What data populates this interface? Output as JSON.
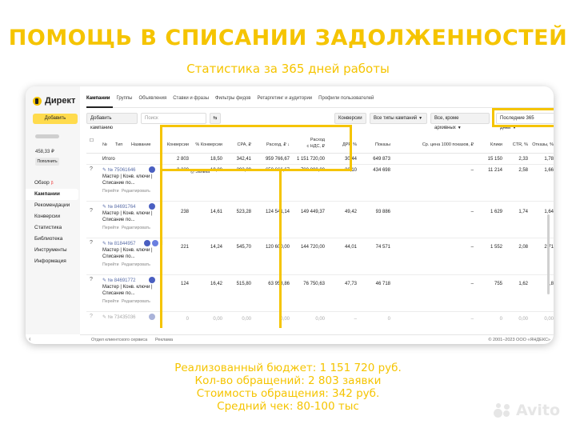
{
  "headline": "ПОМОЩЬ В СПИСАНИИ ЗАДОЛЖЕННОСТЕЙ",
  "subheadline": "Статистика за 365 дней работы",
  "app": {
    "logo": "Директ",
    "add_button": "Добавить",
    "balance": "458,33 ₽",
    "topup_button": "Пополнить",
    "menu": [
      {
        "label": "Обзор",
        "beta": "β"
      },
      {
        "label": "Кампании",
        "active": true
      },
      {
        "label": "Рекомендации"
      },
      {
        "label": "Конверсии"
      },
      {
        "label": "Статистика"
      },
      {
        "label": "Библиотека"
      },
      {
        "label": "Инструменты"
      },
      {
        "label": "Информация"
      }
    ],
    "tabs": [
      "Кампании",
      "Группы",
      "Объявления",
      "Ставки и фразы",
      "Фильтры фидов",
      "Ретаргетинг и аудитории",
      "Профили пользователей"
    ],
    "toolbar": {
      "add_campaign": "Добавить кампанию",
      "search_placeholder": "Поиск",
      "conversions": "Конверсии",
      "campaign_types": "Все типы кампаний",
      "archive_filter": "Все, кроме архивных",
      "period": "Последние 365 дней"
    },
    "goal_label": "Заявка",
    "columns": {
      "no": "№",
      "type": "Тип",
      "name": "Название",
      "conversions": "Конверсии",
      "conv_pct": "% Конверсии",
      "cpa": "CPA, ₽",
      "spend": "Расход, ₽ ↓",
      "spend_vat_1": "Расход",
      "spend_vat_2": "с НДС, ₽",
      "drr": "ДРР, %",
      "impressions": "Показы",
      "avg_cpm": "Ср. цена 1000 показов, ₽",
      "clicks": "Клики",
      "ctr": "CTR, %",
      "bounce": "Отказы, %"
    },
    "total": {
      "label": "Итого",
      "conversions": "2 803",
      "conv_pct": "18,50",
      "cpa": "342,41",
      "spend": "959 766,67",
      "spend_vat": "1 151 720,00",
      "drr": "30,44",
      "impressions": "649 873",
      "avg_cpm": "",
      "clicks": "15 150",
      "ctr": "2,33",
      "bounce": "1,78"
    },
    "rows": [
      {
        "id": "№ 75061646",
        "name1": "Мастер | Конв. ключи |",
        "name2": "Списание по...",
        "go": "Перейти",
        "edit": "Редактировать",
        "conversions": "2 220",
        "conv_pct": "19,80",
        "cpa": "293,09",
        "spend": "650 666,67",
        "spend_vat": "780 800,00",
        "drr": "26,10",
        "impressions": "434 698",
        "avg_cpm": "–",
        "clicks": "11 214",
        "ctr": "2,58",
        "bounce": "1,66"
      },
      {
        "id": "№ 84691764",
        "name1": "Мастер | Конв. ключи |",
        "name2": "Списание по...",
        "go": "Перейти",
        "edit": "Редактировать",
        "conversions": "238",
        "conv_pct": "14,61",
        "cpa": "523,28",
        "spend": "124 541,14",
        "spend_vat": "149 449,37",
        "drr": "49,42",
        "impressions": "93 886",
        "avg_cpm": "–",
        "clicks": "1 629",
        "ctr": "1,74",
        "bounce": "1,64"
      },
      {
        "id": "№ 81844957",
        "name1": "Мастер | Конв. ключи |",
        "name2": "Списание по...",
        "go": "Перейти",
        "edit": "Редактировать",
        "conversions": "221",
        "conv_pct": "14,24",
        "cpa": "545,70",
        "spend": "120 600,00",
        "spend_vat": "144 720,00",
        "drr": "44,01",
        "impressions": "74 571",
        "avg_cpm": "–",
        "clicks": "1 552",
        "ctr": "2,08",
        "bounce": "2,71"
      },
      {
        "id": "№ 84691772",
        "name1": "Мастер | Конв. ключи |",
        "name2": "Списание по...",
        "go": "Перейти",
        "edit": "Редактировать",
        "conversions": "124",
        "conv_pct": "16,42",
        "cpa": "515,80",
        "spend": "63 958,86",
        "spend_vat": "76 750,63",
        "drr": "47,73",
        "impressions": "46 718",
        "avg_cpm": "–",
        "clicks": "755",
        "ctr": "1,62",
        "bounce": "1,8"
      },
      {
        "id": "№ 73435036",
        "name1": "",
        "name2": "",
        "go": "",
        "edit": "",
        "conversions": "0",
        "conv_pct": "0,00",
        "cpa": "0,00",
        "spend": "0,00",
        "spend_vat": "0,00",
        "drr": "–",
        "impressions": "0",
        "avg_cpm": "–",
        "clicks": "0",
        "ctr": "0,00",
        "bounce": "0,00"
      }
    ],
    "footer": {
      "support": "Отдел клиентского сервиса",
      "ads": "Реклама",
      "copyright": "© 2001–2023 ООО «ЯНДЕКС»"
    }
  },
  "summary": [
    "Реализованный бюджет: 1 151 720 руб.",
    "Кол-во обращений: 2 803 заявки",
    "Стоимость обращения: 342 руб.",
    "Средний чек: 80-100 тыс"
  ],
  "watermark": "Avito",
  "colors": {
    "accent": "#f5c400",
    "button": "#ffdb4d",
    "link": "#5a6ea8"
  }
}
